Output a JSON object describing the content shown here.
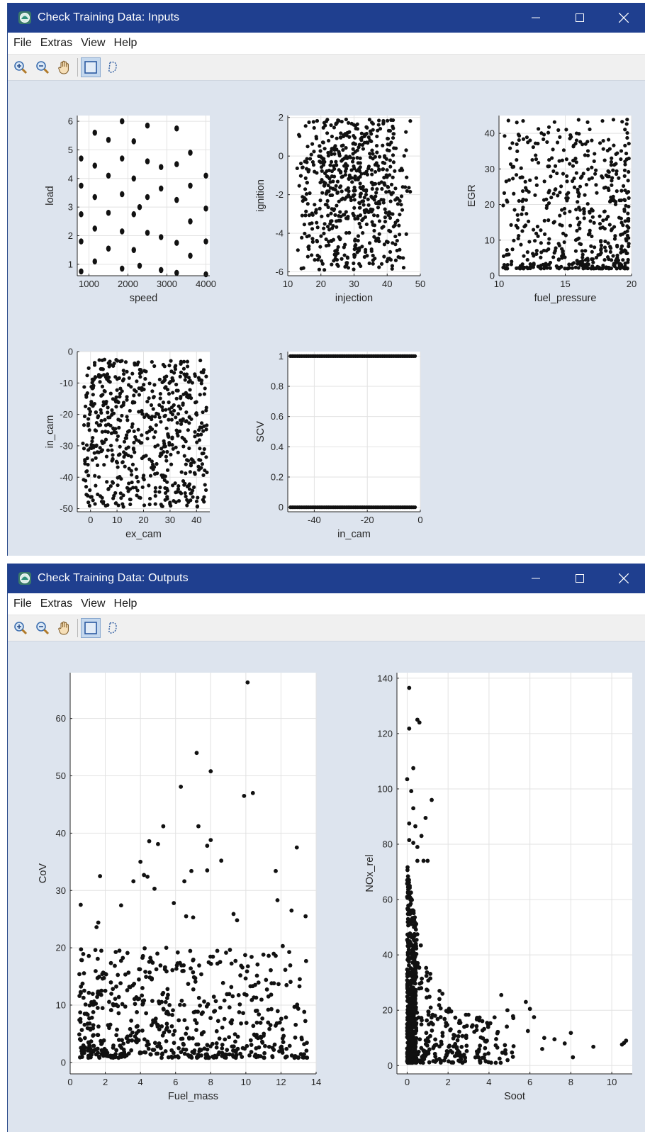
{
  "windows": [
    {
      "title": "Check Training Data: Inputs",
      "menu": [
        "File",
        "Extras",
        "View",
        "Help"
      ],
      "toolbar": [
        "zoom-in-icon",
        "zoom-out-icon",
        "pan-hand-icon",
        "rectangle-select-icon",
        "lasso-select-icon"
      ],
      "controls": [
        "minimize-icon",
        "maximize-icon",
        "close-icon"
      ]
    },
    {
      "title": "Check Training Data: Outputs",
      "menu": [
        "File",
        "Extras",
        "View",
        "Help"
      ],
      "toolbar": [
        "zoom-in-icon",
        "zoom-out-icon",
        "pan-hand-icon",
        "rectangle-select-icon",
        "lasso-select-icon"
      ],
      "controls": [
        "minimize-icon",
        "maximize-icon",
        "close-icon"
      ]
    }
  ],
  "colors": {
    "titlebar": "#1f3f8f",
    "figure_background": "#dde4ee",
    "axes_background": "#ffffff",
    "marker": "#111111",
    "grid": "#e2e2e2"
  },
  "chart_data": [
    {
      "type": "scatter",
      "window": 0,
      "xlabel": "speed",
      "ylabel": "load",
      "xlim": [
        700,
        4100
      ],
      "ylim": [
        0.6,
        6.2
      ],
      "xticks": [
        1000,
        2000,
        3000,
        4000
      ],
      "yticks": [
        1,
        2,
        3,
        4,
        5,
        6
      ],
      "grid": true,
      "pattern": "clustered-grid",
      "points": [
        [
          800,
          0.75
        ],
        [
          800,
          1.8
        ],
        [
          800,
          2.75
        ],
        [
          800,
          3.75
        ],
        [
          800,
          4.7
        ],
        [
          1150,
          1.1
        ],
        [
          1150,
          2.25
        ],
        [
          1150,
          3.35
        ],
        [
          1150,
          4.45
        ],
        [
          1150,
          5.6
        ],
        [
          1500,
          1.55
        ],
        [
          1500,
          2.8
        ],
        [
          1500,
          4.1
        ],
        [
          1500,
          5.35
        ],
        [
          1850,
          0.85
        ],
        [
          1850,
          2.15
        ],
        [
          1850,
          3.45
        ],
        [
          1850,
          4.7
        ],
        [
          1850,
          6.0
        ],
        [
          2150,
          1.5
        ],
        [
          2150,
          2.75
        ],
        [
          2150,
          4.0
        ],
        [
          2150,
          5.3
        ],
        [
          2300,
          0.95
        ],
        [
          2300,
          3.0
        ],
        [
          2500,
          2.1
        ],
        [
          2500,
          3.35
        ],
        [
          2500,
          4.6
        ],
        [
          2500,
          5.85
        ],
        [
          2850,
          0.8
        ],
        [
          2850,
          1.95
        ],
        [
          2850,
          3.65
        ],
        [
          2850,
          4.4
        ],
        [
          3250,
          0.7
        ],
        [
          3250,
          1.75
        ],
        [
          3250,
          3.25
        ],
        [
          3250,
          4.5
        ],
        [
          3250,
          5.75
        ],
        [
          3600,
          1.3
        ],
        [
          3600,
          2.5
        ],
        [
          3600,
          3.75
        ],
        [
          3600,
          4.9
        ],
        [
          4000,
          0.65
        ],
        [
          4000,
          1.8
        ],
        [
          4000,
          2.95
        ],
        [
          4000,
          4.1
        ]
      ]
    },
    {
      "type": "scatter",
      "window": 0,
      "xlabel": "injection",
      "ylabel": "ignition",
      "xlim": [
        10,
        50
      ],
      "ylim": [
        -6.2,
        2.1
      ],
      "xticks": [
        10,
        20,
        30,
        40,
        50
      ],
      "yticks": [
        -6,
        -4,
        -2,
        0,
        2
      ],
      "grid": true,
      "pattern": "dense-uniform",
      "n_points": 640,
      "seed": 11,
      "xr": [
        12,
        48
      ],
      "yr": [
        -5.9,
        1.9
      ],
      "xmode": "center",
      "ymode": "uniform"
    },
    {
      "type": "scatter",
      "window": 0,
      "xlabel": "fuel_pressure",
      "ylabel": "EGR",
      "xlim": [
        10,
        20
      ],
      "ylim": [
        0,
        45
      ],
      "xticks": [
        10,
        15,
        20
      ],
      "yticks": [
        0,
        10,
        20,
        30,
        40
      ],
      "grid": true,
      "pattern": "dense-lower-right",
      "n_points": 560,
      "seed": 23,
      "xr": [
        10.3,
        19.8
      ],
      "yr": [
        2,
        44
      ],
      "xmode": "right",
      "ymode": "low"
    },
    {
      "type": "scatter",
      "window": 0,
      "xlabel": "ex_cam",
      "ylabel": "in_cam",
      "xlim": [
        -5,
        45
      ],
      "ylim": [
        -51,
        0
      ],
      "xticks": [
        0,
        10,
        20,
        30,
        40
      ],
      "yticks": [
        -50,
        -40,
        -30,
        -20,
        -10,
        0
      ],
      "grid": true,
      "pattern": "dense-uniform",
      "n_points": 640,
      "seed": 37,
      "xr": [
        -3,
        44
      ],
      "yr": [
        -49.5,
        -2.5
      ],
      "xmode": "uniform",
      "ymode": "uniform"
    },
    {
      "type": "scatter",
      "window": 0,
      "xlabel": "in_cam",
      "ylabel": "SCV",
      "xlim": [
        -50,
        0
      ],
      "ylim": [
        -0.03,
        1.03
      ],
      "xticks": [
        -40,
        -20,
        0
      ],
      "xticklabels": [
        "-40",
        "-20",
        "0"
      ],
      "yticks": [
        0,
        0.2,
        0.4,
        0.6,
        0.8,
        1
      ],
      "yticklabels": [
        "0",
        "0.2",
        "0.4",
        "0.6",
        "0.8",
        "1"
      ],
      "grid": true,
      "pattern": "binary",
      "levels": [
        0,
        1
      ],
      "x_from": -49,
      "x_to": -2
    },
    {
      "type": "scatter",
      "window": 1,
      "xlabel": "Fuel_mass",
      "ylabel": "CoV",
      "xlim": [
        0,
        14
      ],
      "ylim": [
        -2,
        68
      ],
      "xticks": [
        0,
        2,
        4,
        6,
        8,
        10,
        12,
        14
      ],
      "yticks": [
        0,
        10,
        20,
        30,
        40,
        50,
        60
      ],
      "grid": true,
      "pattern": "dense-low",
      "n_points": 620,
      "seed": 53,
      "xr": [
        0.5,
        13.5
      ],
      "yr": [
        0.8,
        20
      ],
      "xmode": "left",
      "ymode": "low",
      "extra_points": [
        [
          10.1,
          66.3
        ],
        [
          7.2,
          54.0
        ],
        [
          8.0,
          50.8
        ],
        [
          6.3,
          48.1
        ],
        [
          9.9,
          46.5
        ],
        [
          10.4,
          47.0
        ],
        [
          5.3,
          41.2
        ],
        [
          7.3,
          41.2
        ],
        [
          4.5,
          38.6
        ],
        [
          5.0,
          38.1
        ],
        [
          7.8,
          37.8
        ],
        [
          8.0,
          38.8
        ],
        [
          12.9,
          37.5
        ],
        [
          4.0,
          35.0
        ],
        [
          8.6,
          35.2
        ],
        [
          4.2,
          32.7
        ],
        [
          3.6,
          31.6
        ],
        [
          6.5,
          31.6
        ],
        [
          6.9,
          33.4
        ],
        [
          7.8,
          33.5
        ],
        [
          11.7,
          33.4
        ],
        [
          4.4,
          32.4
        ],
        [
          4.8,
          30.3
        ],
        [
          1.7,
          32.5
        ],
        [
          0.6,
          27.5
        ],
        [
          2.9,
          27.4
        ],
        [
          5.9,
          27.8
        ],
        [
          11.8,
          28.3
        ],
        [
          12.6,
          26.5
        ],
        [
          13.4,
          25.5
        ],
        [
          9.3,
          25.9
        ],
        [
          9.5,
          24.8
        ],
        [
          6.6,
          25.5
        ],
        [
          7.0,
          25.3
        ],
        [
          1.6,
          24.4
        ],
        [
          1.5,
          23.6
        ],
        [
          12.1,
          20.3
        ],
        [
          11.0,
          18.8
        ],
        [
          11.3,
          18.6
        ],
        [
          11.7,
          18.6
        ]
      ]
    },
    {
      "type": "scatter",
      "window": 1,
      "xlabel": "Soot",
      "ylabel": "NOx_rel",
      "xlim": [
        -0.5,
        11
      ],
      "ylim": [
        -3,
        142
      ],
      "xticks": [
        0,
        2,
        4,
        6,
        8,
        10
      ],
      "yticks": [
        0,
        20,
        40,
        60,
        80,
        100,
        120,
        140
      ],
      "grid": true,
      "pattern": "L-shaped-decay",
      "n_points": 680,
      "seed": 71,
      "extra_points": [
        [
          0.1,
          136.5
        ],
        [
          0.1,
          121.8
        ],
        [
          0.5,
          125.0
        ],
        [
          0.6,
          124.0
        ],
        [
          0.3,
          107.5
        ],
        [
          0.0,
          103.5
        ],
        [
          0.2,
          99.2
        ],
        [
          1.2,
          96.0
        ],
        [
          0.3,
          93.0
        ],
        [
          0.9,
          89.5
        ],
        [
          0.1,
          87.5
        ],
        [
          0.4,
          86.5
        ],
        [
          0.7,
          83.0
        ],
        [
          0.1,
          81.5
        ],
        [
          0.3,
          80.5
        ],
        [
          0.5,
          79.0
        ],
        [
          0.5,
          74.0
        ],
        [
          0.8,
          74.0
        ],
        [
          1.0,
          74.0
        ],
        [
          10.7,
          9.0
        ],
        [
          10.6,
          8.2
        ],
        [
          10.5,
          7.6
        ],
        [
          9.1,
          6.8
        ],
        [
          8.1,
          3.0
        ],
        [
          8.0,
          11.8
        ],
        [
          7.7,
          8.0
        ],
        [
          7.2,
          9.5
        ],
        [
          6.7,
          10.0
        ],
        [
          6.6,
          6.0
        ],
        [
          6.2,
          17.5
        ],
        [
          6.0,
          20.5
        ],
        [
          5.8,
          23.0
        ],
        [
          5.9,
          12.5
        ],
        [
          5.2,
          7.0
        ],
        [
          4.9,
          20.0
        ],
        [
          4.6,
          25.5
        ]
      ]
    }
  ]
}
